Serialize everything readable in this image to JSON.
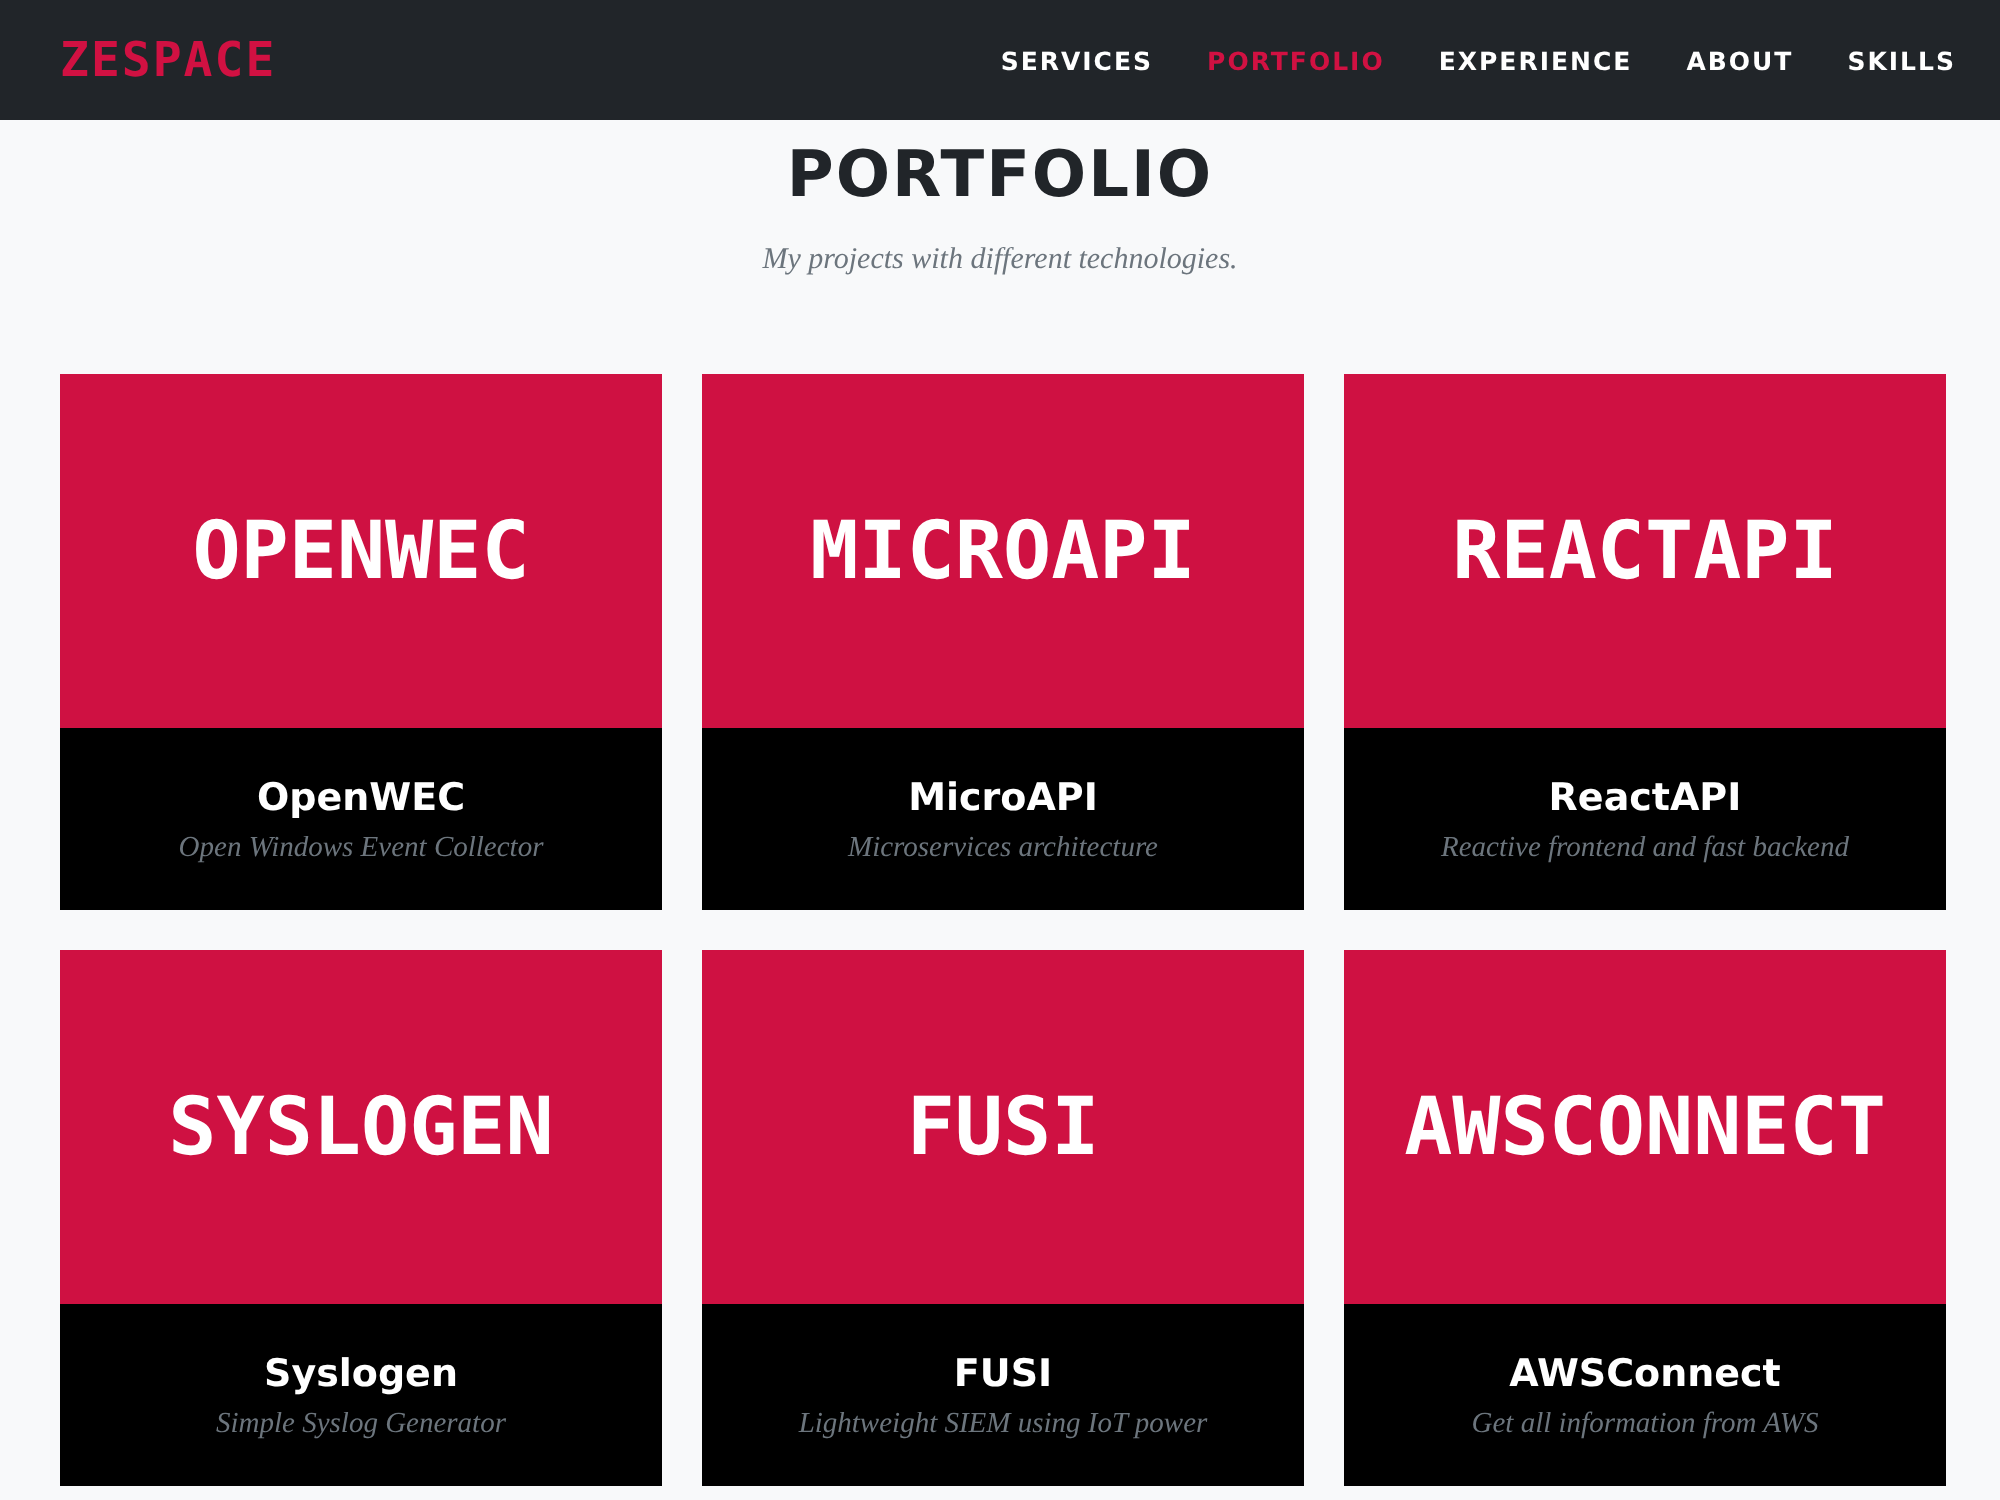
{
  "navbar": {
    "logo": "ZESPACE",
    "items": [
      {
        "label": "SERVICES",
        "selected": false
      },
      {
        "label": "PORTFOLIO",
        "selected": true
      },
      {
        "label": "EXPERIENCE",
        "selected": false
      },
      {
        "label": "ABOUT",
        "selected": false
      },
      {
        "label": "SKILLS",
        "selected": false
      }
    ]
  },
  "section": {
    "title": "PORTFOLIO",
    "subtitle": "My projects with different technologies."
  },
  "projects": [
    {
      "banner_text": "OPENWEC",
      "title": "OpenWEC",
      "description": "Open Windows Event Collector"
    },
    {
      "banner_text": "MICROAPI",
      "title": "MicroAPI",
      "description": "Microservices architecture"
    },
    {
      "banner_text": "REACTAPI",
      "title": "ReactAPI",
      "description": "Reactive frontend and fast backend"
    },
    {
      "banner_text": "SYSLOGEN",
      "title": "Syslogen",
      "description": "Simple Syslog Generator"
    },
    {
      "banner_text": "FUSI",
      "title": "FUSI",
      "description": "Lightweight SIEM using IoT power"
    },
    {
      "banner_text": "AWSCONNECT",
      "title": "AWSConnect",
      "description": "Get all information from AWS"
    }
  ]
}
